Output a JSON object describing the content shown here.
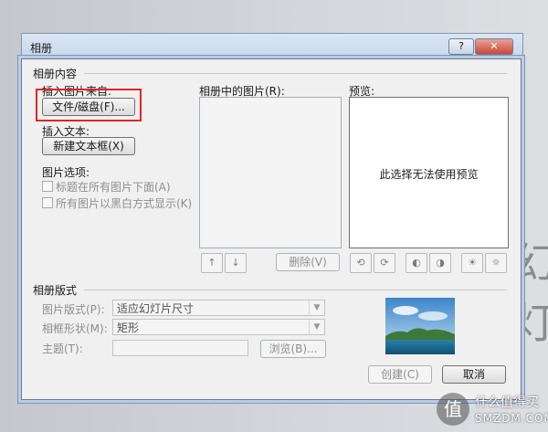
{
  "background": {
    "slide_text": "幻灯"
  },
  "dialog": {
    "title": "相册",
    "help_glyph": "?",
    "close_glyph": "✕"
  },
  "album_content": {
    "section": "相册内容",
    "insert_from_label": "插入图片来自:",
    "file_disk_button": "文件/磁盘(F)...",
    "insert_text_label": "插入文本:",
    "new_textbox_button": "新建文本框(X)",
    "picture_options_label": "图片选项:",
    "caption_below": "标题在所有图片下面(A)",
    "all_black_white": "所有图片以黑白方式显示(K)",
    "pictures_in_album_label": "相册中的图片(R):",
    "move_up_glyph": "↑",
    "move_down_glyph": "↓",
    "remove_button": "删除(V)",
    "preview_label": "预览:",
    "preview_message": "此选择无法使用预览",
    "preview_tool_icons": [
      "rotate-left-icon",
      "rotate-right-icon",
      "contrast-up-icon",
      "contrast-down-icon",
      "brightness-up-icon",
      "brightness-down-icon"
    ]
  },
  "album_layout": {
    "section": "相册版式",
    "picture_layout_label": "图片版式(P):",
    "picture_layout_value": "适应幻灯片尺寸",
    "frame_shape_label": "相框形状(M):",
    "frame_shape_value": "矩形",
    "theme_label": "主题(T):",
    "theme_value": "",
    "browse_button": "浏览(B)..."
  },
  "footer": {
    "create_button": "创建(C)",
    "cancel_button": "取消"
  },
  "watermark": {
    "logo_glyph": "值",
    "line1": "什么值得买",
    "line2": "SMZDM.COM"
  },
  "colors": {
    "highlight_box": "#e02424",
    "title_bar": "#c4d5ea"
  }
}
